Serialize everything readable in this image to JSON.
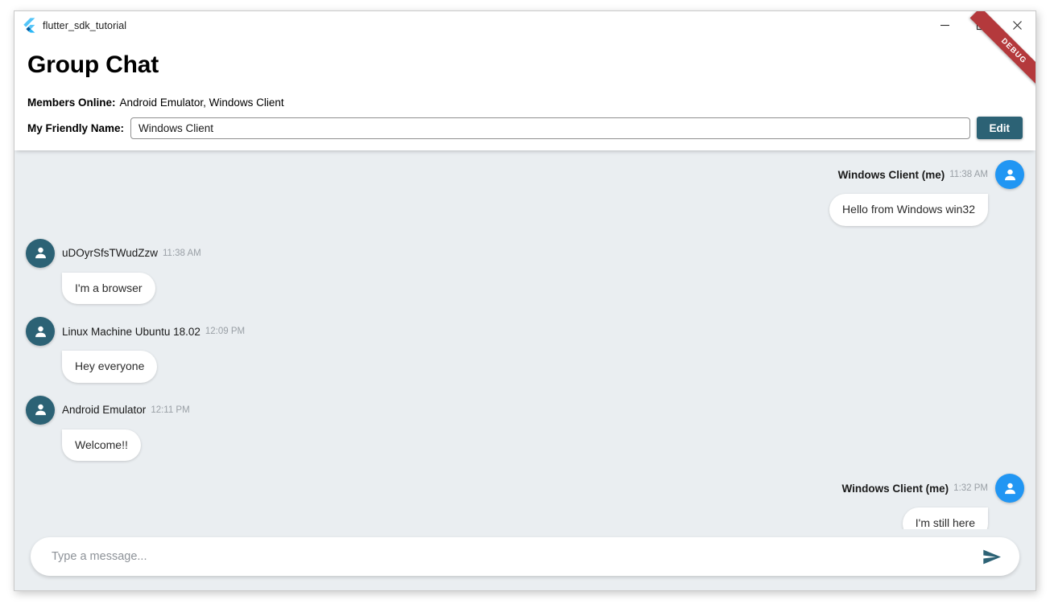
{
  "window": {
    "title": "flutter_sdk_tutorial",
    "app_icon": "flutter-logo-icon",
    "controls": {
      "minimize": "minimize-icon",
      "maximize": "maximize-icon",
      "close": "close-icon"
    },
    "debug_ribbon": "DEBUG"
  },
  "header": {
    "page_title": "Group Chat",
    "members_label": "Members Online:",
    "members_value": "Android Emulator, Windows Client",
    "friendly_name_label": "My Friendly Name:",
    "friendly_name_value": "Windows Client",
    "friendly_name_placeholder": "",
    "edit_label": "Edit"
  },
  "colors": {
    "accent_teal": "#2c6275",
    "avatar_me": "#2196f3",
    "avatar_them": "#2c6275",
    "debug_red": "#b4393c",
    "chat_background": "#eaeef1",
    "bubble": "#ffffff",
    "timestamp": "#9aa0a6"
  },
  "messages": [
    {
      "sender": "Windows Client (me)",
      "time": "11:38 AM",
      "text": "Hello from Windows win32",
      "self": true,
      "avatar": "person-icon"
    },
    {
      "sender": "uDOyrSfsTWudZzw",
      "time": "11:38 AM",
      "text": "I'm a browser",
      "self": false,
      "avatar": "person-icon"
    },
    {
      "sender": "Linux Machine Ubuntu 18.02",
      "time": "12:09 PM",
      "text": "Hey everyone",
      "self": false,
      "avatar": "person-icon"
    },
    {
      "sender": "Android Emulator",
      "time": "12:11 PM",
      "text": "Welcome!!",
      "self": false,
      "avatar": "person-icon"
    },
    {
      "sender": "Windows Client (me)",
      "time": "1:32 PM",
      "text": "I'm still here",
      "self": true,
      "avatar": "person-icon"
    }
  ],
  "composer": {
    "placeholder": "Type a message...",
    "value": "",
    "send_icon": "send-icon"
  }
}
